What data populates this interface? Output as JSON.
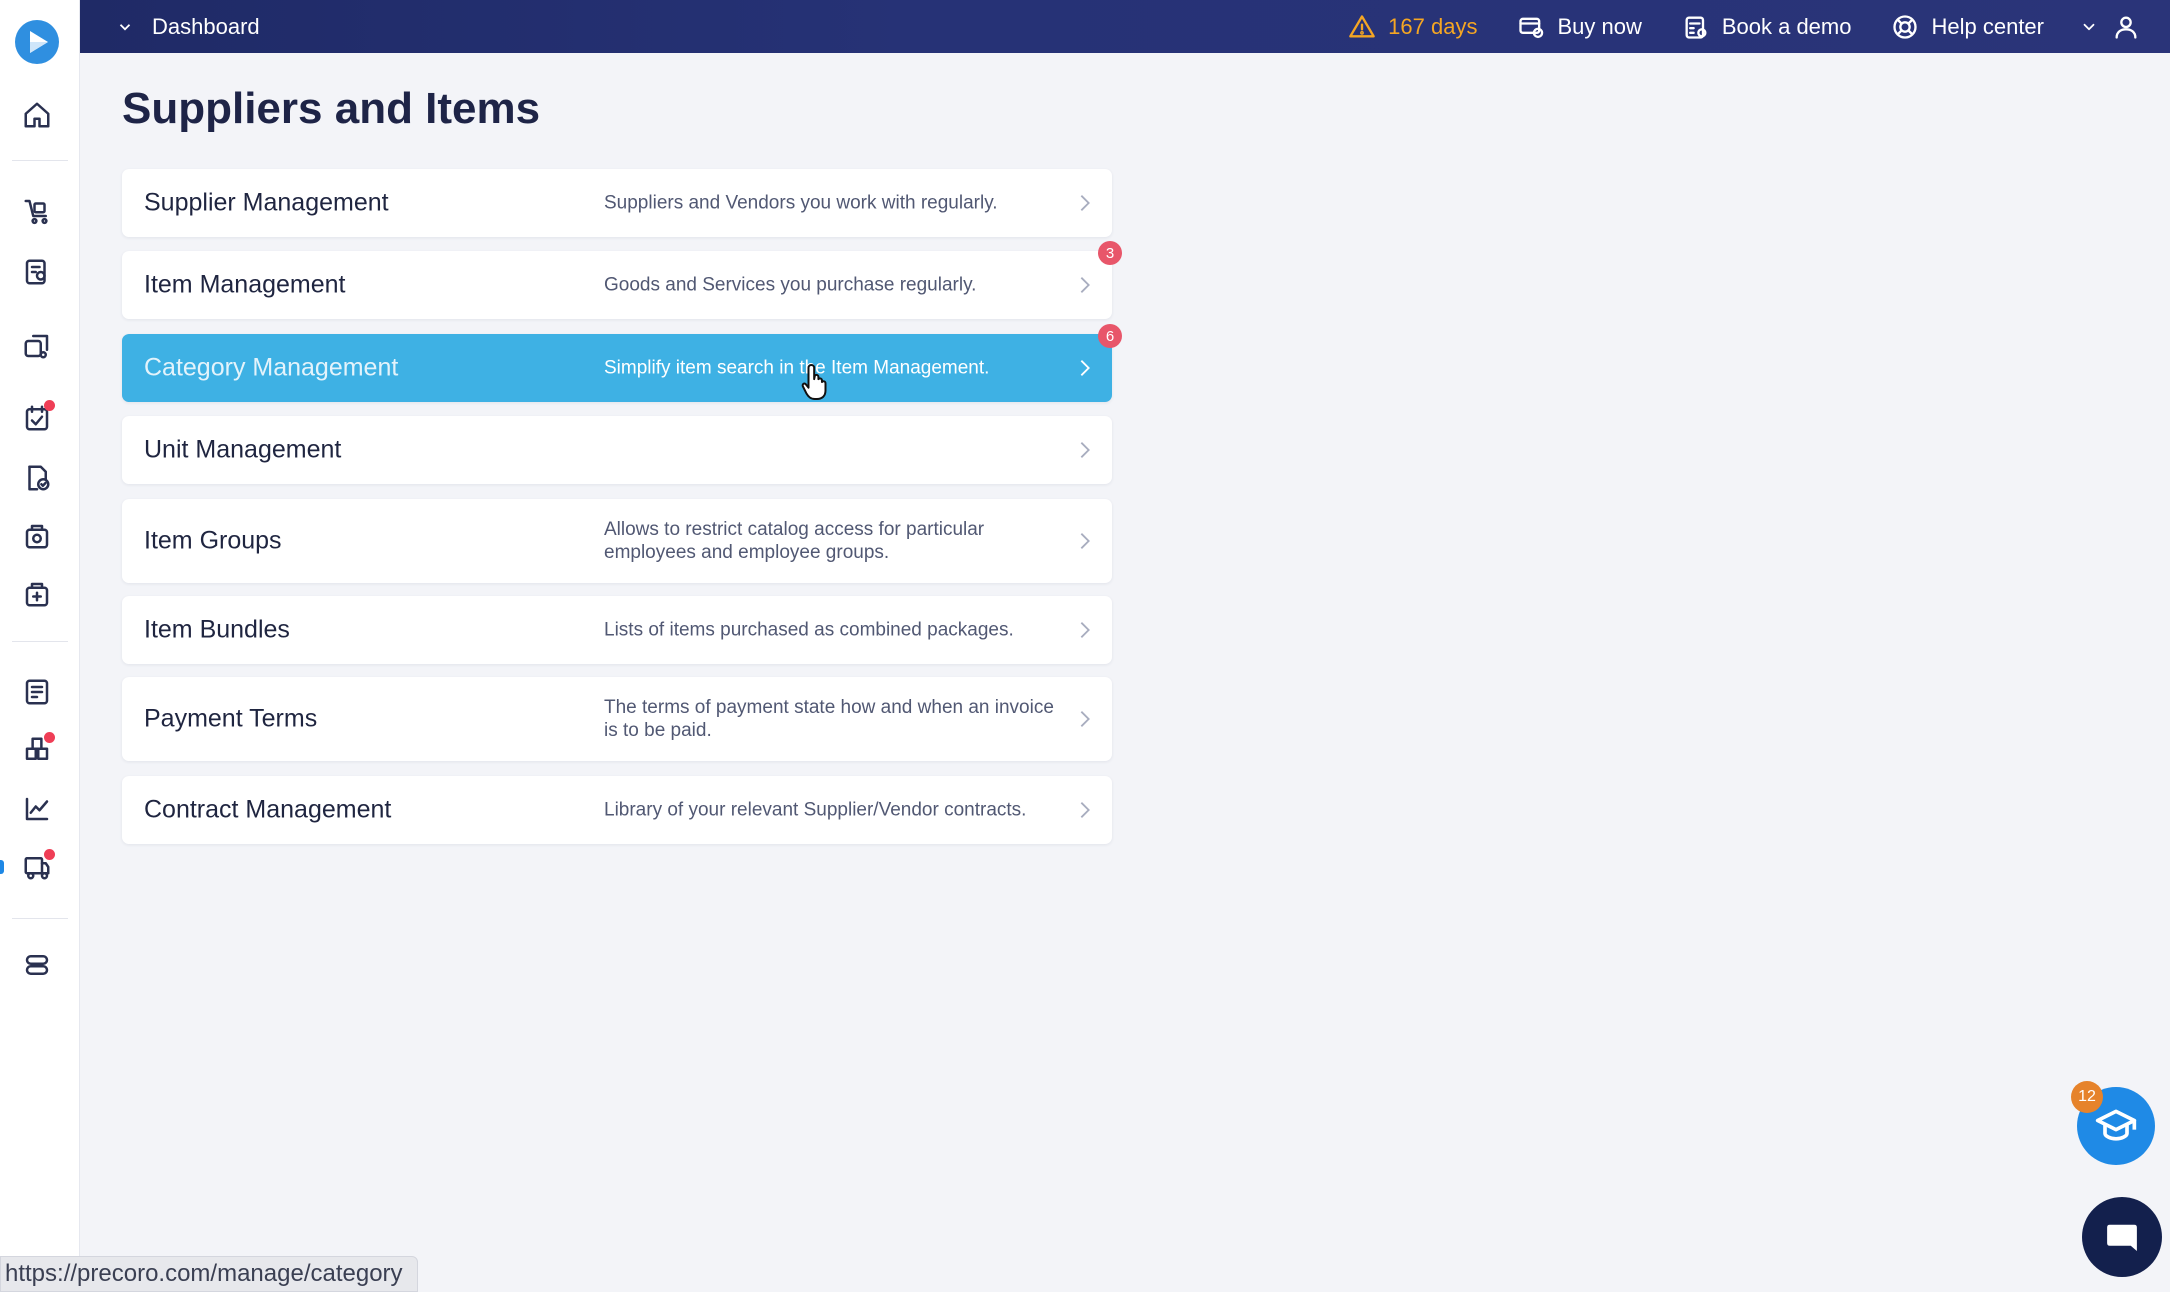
{
  "topbar": {
    "breadcrumb": "Dashboard",
    "trial": "167 days",
    "buy_now": "Buy now",
    "book_demo": "Book a demo",
    "help_center": "Help center"
  },
  "page": {
    "title": "Suppliers and Items"
  },
  "cards": [
    {
      "title": "Supplier Management",
      "description": "Suppliers and Vendors you work with regularly.",
      "badge": ""
    },
    {
      "title": "Item Management",
      "description": "Goods and Services you purchase regularly.",
      "badge": "3"
    },
    {
      "title": "Category Management",
      "description": "Simplify item search in the Item Management.",
      "badge": "6"
    },
    {
      "title": "Unit Management",
      "description": "",
      "badge": ""
    },
    {
      "title": "Item Groups",
      "description": "Allows to restrict catalog access for particular employees and employee groups.",
      "badge": ""
    },
    {
      "title": "Item Bundles",
      "description": "Lists of items purchased as combined packages.",
      "badge": ""
    },
    {
      "title": "Payment Terms",
      "description": "The terms of payment state how and when an invoice is to be paid.",
      "badge": ""
    },
    {
      "title": "Contract Management",
      "description": "Library of your relevant Supplier/Vendor contracts.",
      "badge": ""
    }
  ],
  "floating": {
    "learning_badge": "12"
  },
  "status_bar": {
    "url": "https://precoro.com/manage/category"
  },
  "colors": {
    "topbar": "#263276",
    "active_card": "#3eb1e4",
    "badge": "#e8566a",
    "trial": "#f5a623"
  }
}
